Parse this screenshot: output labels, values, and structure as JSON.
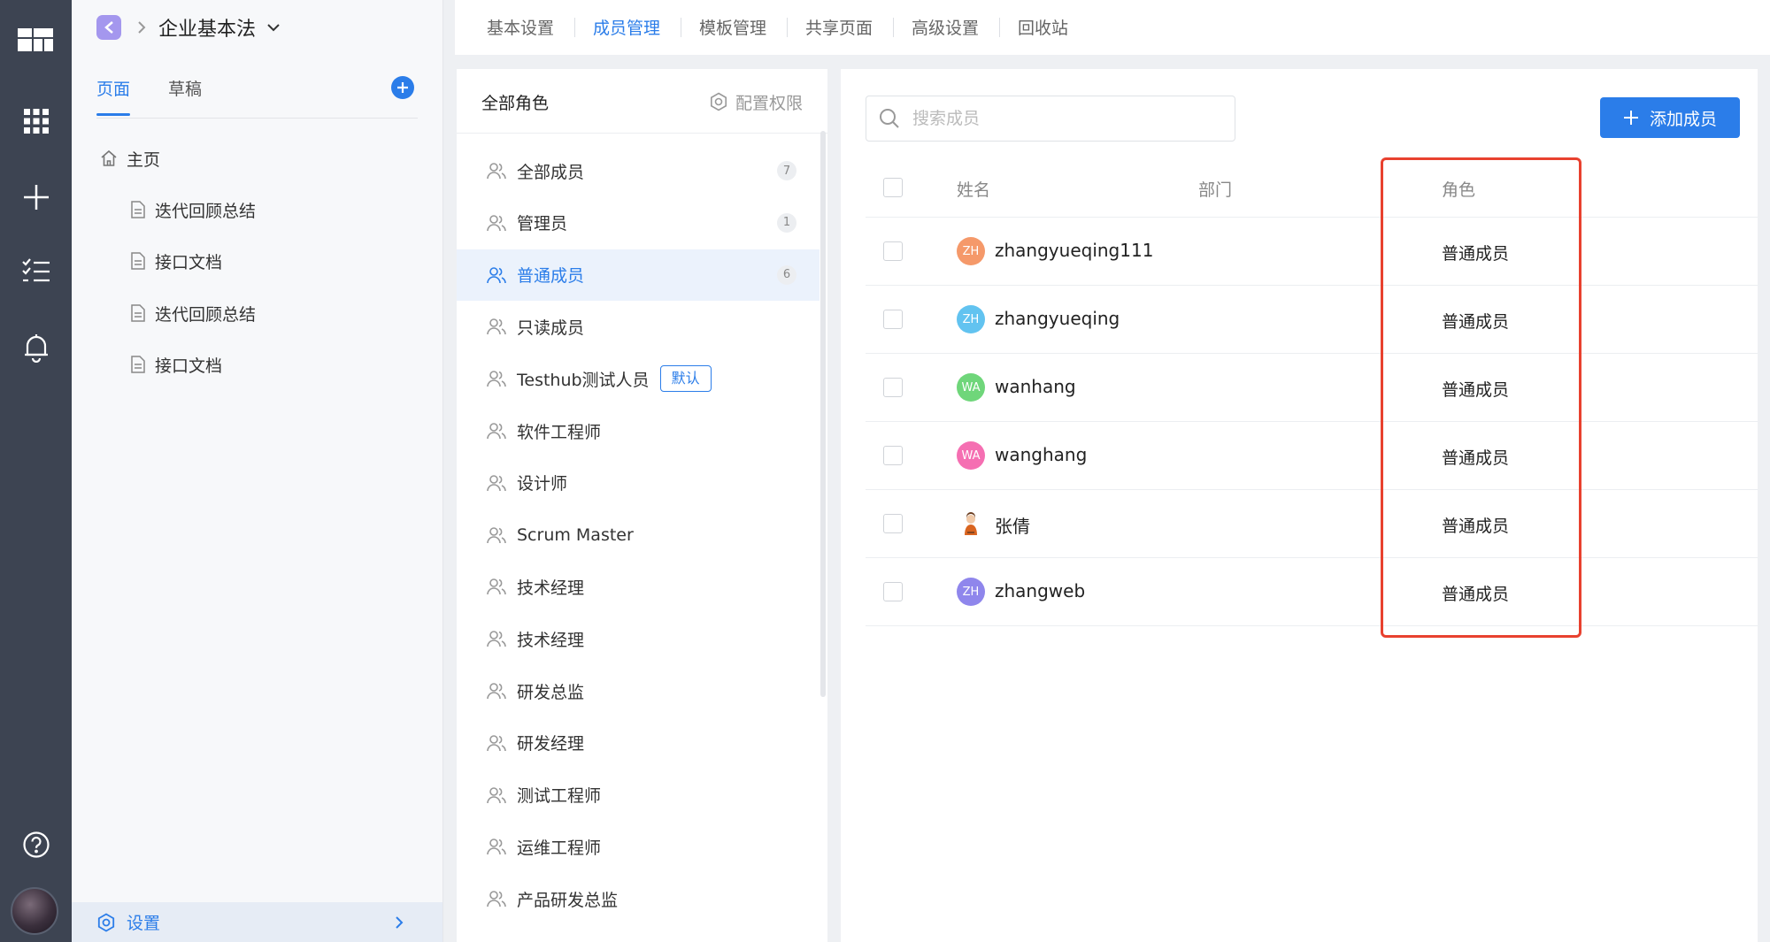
{
  "space": {
    "name": "企业基本法"
  },
  "left_tabs": [
    {
      "label": "页面"
    },
    {
      "label": "草稿"
    }
  ],
  "tree": [
    {
      "label": "主页"
    },
    {
      "label": "迭代回顾总结"
    },
    {
      "label": "接口文档"
    },
    {
      "label": "迭代回顾总结"
    },
    {
      "label": "接口文档"
    }
  ],
  "settings_label": "设置",
  "top_tabs": [
    {
      "label": "基本设置"
    },
    {
      "label": "成员管理"
    },
    {
      "label": "模板管理"
    },
    {
      "label": "共享页面"
    },
    {
      "label": "高级设置"
    },
    {
      "label": "回收站"
    }
  ],
  "roles_panel": {
    "title": "全部角色",
    "config_label": "配置权限"
  },
  "roles": [
    {
      "label": "全部成员",
      "count": "7"
    },
    {
      "label": "管理员",
      "count": "1"
    },
    {
      "label": "普通成员",
      "count": "6",
      "selected": true
    },
    {
      "label": "只读成员"
    },
    {
      "label": "Testhub测试人员",
      "badge": "默认"
    },
    {
      "label": "软件工程师"
    },
    {
      "label": "设计师"
    },
    {
      "label": "Scrum Master"
    },
    {
      "label": "技术经理"
    },
    {
      "label": "技术经理"
    },
    {
      "label": "研发总监"
    },
    {
      "label": "研发经理"
    },
    {
      "label": "测试工程师"
    },
    {
      "label": "运维工程师"
    },
    {
      "label": "产品研发总监"
    }
  ],
  "members_panel": {
    "search_placeholder": "搜索成员",
    "add_label": "添加成员",
    "columns": {
      "name": "姓名",
      "dept": "部门",
      "role": "角色"
    }
  },
  "members": [
    {
      "initials": "ZH",
      "name": "zhangyueqing111",
      "role": "普通成员",
      "color": "#f5996a"
    },
    {
      "initials": "ZH",
      "name": "zhangyueqing",
      "role": "普通成员",
      "color": "#62c3f0"
    },
    {
      "initials": "WA",
      "name": "wanhang",
      "role": "普通成员",
      "color": "#6fd67a"
    },
    {
      "initials": "WA",
      "name": "wanghang",
      "role": "普通成员",
      "color": "#f56fb2"
    },
    {
      "initials": "",
      "name": "张倩",
      "role": "普通成员",
      "color": "#ffffff"
    },
    {
      "initials": "ZH",
      "name": "zhangweb",
      "role": "普通成员",
      "color": "#8f86ec"
    }
  ],
  "colors": {
    "accent": "#2b7de9",
    "rail": "#3d4452",
    "highlight": "#e8412f"
  }
}
